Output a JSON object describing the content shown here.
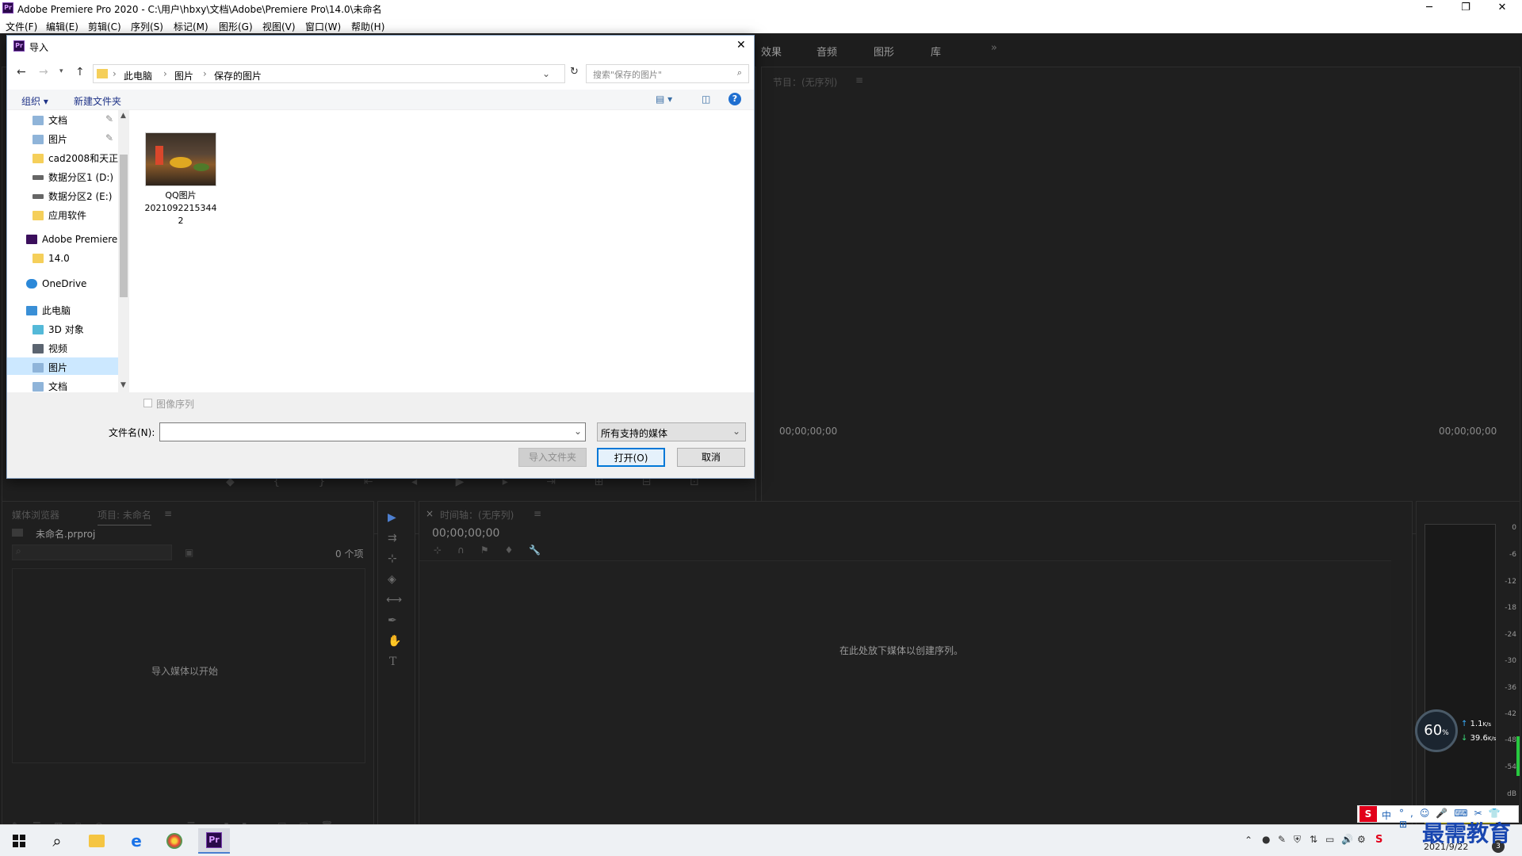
{
  "window": {
    "title": "Adobe Premiere Pro 2020 - C:\\用户\\hbxy\\文档\\Adobe\\Premiere Pro\\14.0\\未命名",
    "app_icon": "Pr",
    "controls": [
      "─",
      "❐",
      "✕"
    ]
  },
  "menu": [
    "文件(F)",
    "编辑(E)",
    "剪辑(C)",
    "序列(S)",
    "标记(M)",
    "图形(G)",
    "视图(V)",
    "窗口(W)",
    "帮助(H)"
  ],
  "workspace_tabs": [
    "效果",
    "音频",
    "图形",
    "库",
    "»"
  ],
  "program_monitor": {
    "title": "节目：(无序列)",
    "menu_glyph": "≡",
    "timecode_left": "00;00;00;00",
    "timecode_right": "00;00;00;00"
  },
  "project_panel": {
    "tabs": [
      "媒体浏览器",
      "项目: 未命名",
      "≡"
    ],
    "filename": "未命名.prproj",
    "item_count": "0 个项",
    "empty_text": "导入媒体以开始"
  },
  "timeline": {
    "close": "×",
    "title": "时间轴：(无序列)",
    "menu_glyph": "≡",
    "timecode": "00;00;00;00",
    "empty_text": "在此处放下媒体以创建序列。"
  },
  "audio_meter": {
    "ticks": [
      "0",
      "-6",
      "-12",
      "-18",
      "-24",
      "-30",
      "-36",
      "-42",
      "-48",
      "-54",
      "dB"
    ],
    "speed_percent": "60",
    "speed_unit": "%",
    "upload": "1.1",
    "download": "39.6",
    "rate_unit": "K/s"
  },
  "dialog": {
    "title": "导入",
    "close": "✕",
    "breadcrumb": [
      "此电脑",
      "图片",
      "保存的图片"
    ],
    "search_placeholder": "搜索\"保存的图片\"",
    "toolbar": {
      "organize": "组织 ▾",
      "new_folder": "新建文件夹"
    },
    "nav": [
      {
        "label": "文档",
        "icon": "docs-icon"
      },
      {
        "label": "图片",
        "icon": "pictures-icon"
      },
      {
        "label": "cad2008和天正",
        "icon": "folder-icon"
      },
      {
        "label": "数据分区1 (D:)",
        "icon": "drive-icon"
      },
      {
        "label": "数据分区2 (E:)",
        "icon": "drive-icon"
      },
      {
        "label": "应用软件",
        "icon": "folder-icon"
      },
      {
        "label": "Adobe Premiere",
        "icon": "premiere-icon"
      },
      {
        "label": "14.0",
        "icon": "folder-icon"
      },
      {
        "label": "OneDrive",
        "icon": "cloud-icon"
      },
      {
        "label": "此电脑",
        "icon": "pc-icon"
      },
      {
        "label": "3D 对象",
        "icon": "cube-icon"
      },
      {
        "label": "视频",
        "icon": "video-icon"
      },
      {
        "label": "图片",
        "icon": "pictures-icon"
      },
      {
        "label": "文档",
        "icon": "docs-icon"
      }
    ],
    "file": {
      "name_line1": "QQ图片",
      "name_line2": "2021092215344",
      "name_line3": "2"
    },
    "image_sequence_label": "图像序列",
    "filename_label": "文件名(N):",
    "filename_value": "",
    "filetype": "所有支持的媒体",
    "buttons": {
      "import_folder": "导入文件夹",
      "open": "打开(O)",
      "cancel": "取消"
    },
    "help": "?"
  },
  "taskbar": {
    "ime": "中",
    "date": "2021/9/22",
    "watermark": "最需教育",
    "notify_badge": "3"
  }
}
